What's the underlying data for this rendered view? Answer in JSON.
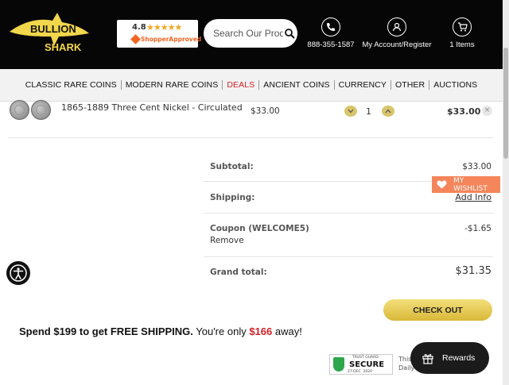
{
  "header": {
    "logo_text_top": "BULLION",
    "logo_text_bottom": "SHARK",
    "shopper_approved": {
      "rating": "4.8",
      "stars": "★★★★★",
      "label": "ShopperApproved"
    },
    "search": {
      "placeholder": "Search Our Prod"
    },
    "phone": {
      "icon": "phone-icon",
      "label": "888-355-1587"
    },
    "account": {
      "icon": "user-icon",
      "label": "My Account/Register"
    },
    "cart": {
      "icon": "cart-icon",
      "label": "1 Items"
    }
  },
  "nav": {
    "items": [
      {
        "label": "CLASSIC RARE COINS"
      },
      {
        "label": "MODERN RARE COINS"
      },
      {
        "label": "DEALS"
      },
      {
        "label": "ANCIENT COINS"
      },
      {
        "label": "CURRENCY"
      },
      {
        "label": "OTHER"
      },
      {
        "label": "AUCTIONS"
      }
    ]
  },
  "cart_item": {
    "name": "1865-1889 Three Cent Nickel - Circulated",
    "price": "$33.00",
    "quantity": "1",
    "total": "$33.00",
    "remove_symbol": "×"
  },
  "totals": {
    "subtotal_label": "Subtotal:",
    "subtotal_value": "$33.00",
    "shipping_label": "Shipping:",
    "shipping_value": "Add Info",
    "coupon_label": "Coupon (WELCOME5)",
    "coupon_value": "-$1.65",
    "coupon_remove": "Remove",
    "grand_label": "Grand total:",
    "grand_value": "$31.35"
  },
  "wishlist": {
    "label": "MY WISHLIST"
  },
  "checkout": {
    "label": "CHECK OUT"
  },
  "free_shipping": {
    "part1": "Spend $199 to get FREE SHIPPING.",
    "part2": " You're only ",
    "amount": "$166",
    "part3": " away!"
  },
  "trust_guard": {
    "top": "TRUST GUARD",
    "label": "SECURE",
    "date": "27 DEC",
    "date2": "2020",
    "side_text_1": "This",
    "side_text_2": "Daily"
  },
  "rewards": {
    "label": "Rewards"
  },
  "colors": {
    "header_bg": "#060606",
    "accent_gold": "#e5c84a",
    "deal_red": "#d12026",
    "wishlist_orange": "#f5855a"
  }
}
